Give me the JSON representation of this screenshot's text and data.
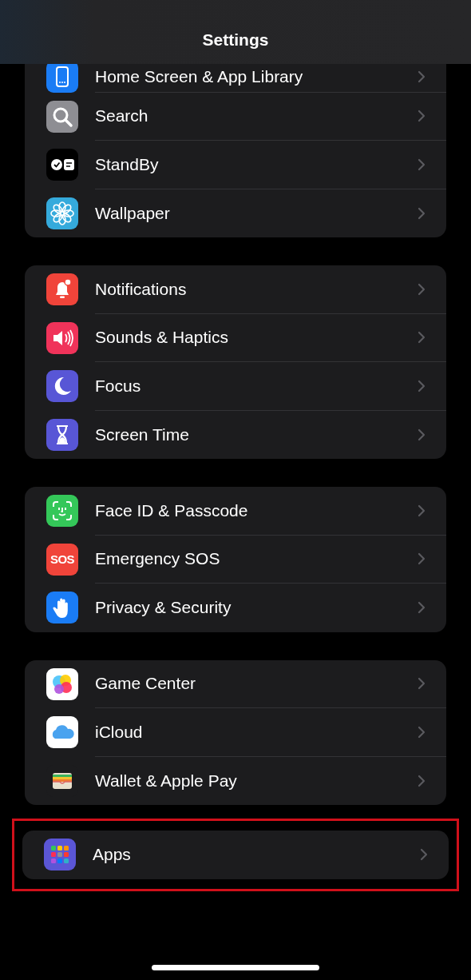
{
  "nav_bar": {
    "title": "Settings"
  },
  "groups": [
    {
      "highlighted": false,
      "items": [
        {
          "label": "Home Screen & App Library",
          "kind": "home"
        },
        {
          "label": "Search",
          "kind": "search"
        },
        {
          "label": "StandBy",
          "kind": "standby"
        },
        {
          "label": "Wallpaper",
          "kind": "wallpaper"
        }
      ]
    },
    {
      "highlighted": false,
      "items": [
        {
          "label": "Notifications",
          "kind": "notifications"
        },
        {
          "label": "Sounds & Haptics",
          "kind": "sounds"
        },
        {
          "label": "Focus",
          "kind": "focus"
        },
        {
          "label": "Screen Time",
          "kind": "screentime"
        }
      ]
    },
    {
      "highlighted": false,
      "items": [
        {
          "label": "Face ID & Passcode",
          "kind": "faceid"
        },
        {
          "label": "Emergency SOS",
          "kind": "sos",
          "icon_text": "SOS"
        },
        {
          "label": "Privacy & Security",
          "kind": "privacy"
        }
      ]
    },
    {
      "highlighted": false,
      "items": [
        {
          "label": "Game Center",
          "kind": "gamecenter"
        },
        {
          "label": "iCloud",
          "kind": "icloud"
        },
        {
          "label": "Wallet & Apple Pay",
          "kind": "wallet"
        }
      ]
    },
    {
      "highlighted": true,
      "items": [
        {
          "label": "Apps",
          "kind": "apps"
        }
      ]
    }
  ]
}
